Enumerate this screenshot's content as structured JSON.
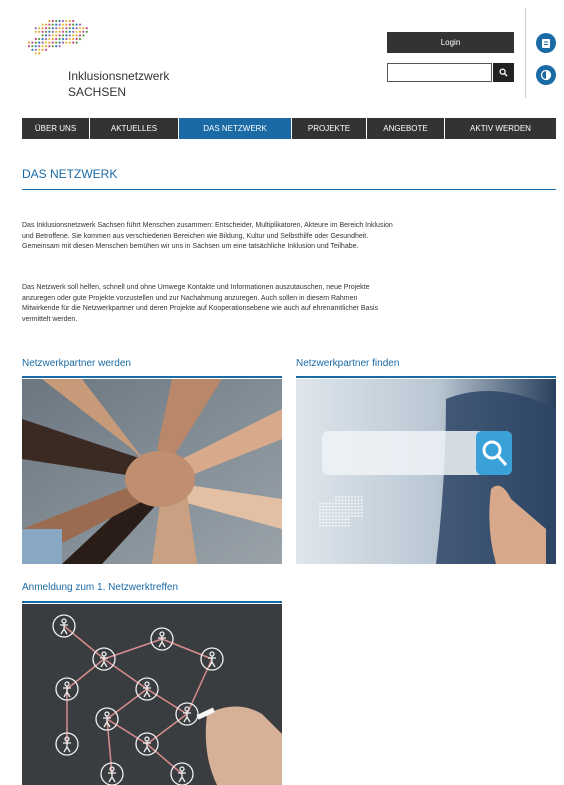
{
  "header": {
    "logo_line1": "Inklusionsnetzwerk",
    "logo_line2": "SACHSEN",
    "login_label": "Login",
    "search_placeholder": "",
    "icons": [
      "search-icon",
      "accessibility-easy-language-icon",
      "accessibility-contrast-icon"
    ]
  },
  "nav": {
    "items": [
      {
        "label": "ÜBER UNS",
        "active": false
      },
      {
        "label": "AKTUELLES",
        "active": false
      },
      {
        "label": "DAS NETZWERK",
        "active": true
      },
      {
        "label": "PROJEKTE",
        "active": false
      },
      {
        "label": "ANGEBOTE",
        "active": false
      },
      {
        "label": "AKTIV WERDEN",
        "active": false
      }
    ]
  },
  "main": {
    "title": "DAS NETZWERK",
    "paragraphs": [
      "Das Inklusionsnetzwerk Sachsen führt Menschen zusammen: Entscheider, Multiplikatoren, Akteure im Bereich Inklusion und Betroffene. Sie kommen aus verschiedenen Bereichen wie Bildung, Kultur und Selbsthilfe oder Gesundheit. Gemeinsam mit diesen Menschen bemühen wir uns in Sachsen um eine tatsächliche Inklusion und Teilhabe.",
      "Das Netzwerk soll helfen, schnell und ohne Umwege Kontakte und Informationen auszutauschen, neue Projekte anzuregen oder gute Projekte vorzustellen und zur Nachahmung anzuregen. Auch sollen in diesem Rahmen Mitwirkende für die Netzwerkpartner und deren Projekte auf Kooperationsebene wie auch auf ehrenamtlicher Basis vermittelt werden."
    ],
    "sections": [
      {
        "title": "Netzwerkpartner werden"
      },
      {
        "title": "Netzwerkpartner finden"
      },
      {
        "title": "Anmeldung zum 1. Netzwerktreffen"
      }
    ]
  },
  "colors": {
    "accent": "#1a6aa6",
    "nav_bg": "#333333"
  }
}
